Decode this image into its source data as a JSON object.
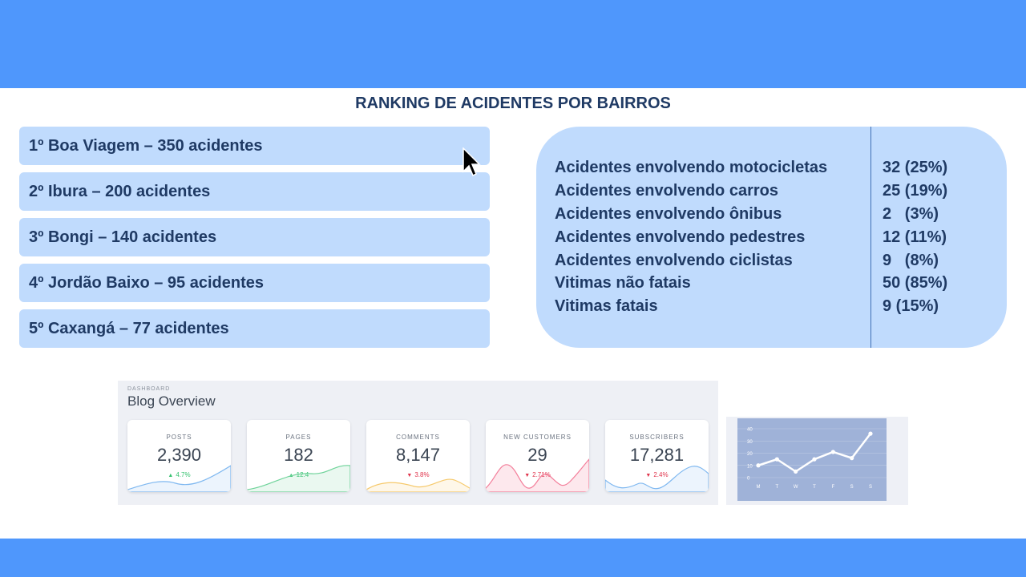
{
  "title": "RANKING DE ACIDENTES POR BAIRROS",
  "ranking": [
    "1º Boa Viagem – 350 acidentes",
    "2º Ibura – 200 acidentes",
    "3º Bongi – 140 acidentes",
    "4º Jordão Baixo – 95 acidentes",
    "5º Caxangá – 77 acidentes"
  ],
  "stats": [
    {
      "label": "Acidentes envolvendo motocicletas",
      "value": "32 (25%)"
    },
    {
      "label": "Acidentes envolvendo carros",
      "value": "25 (19%)"
    },
    {
      "label": "Acidentes envolvendo ônibus",
      "value": "2   (3%)"
    },
    {
      "label": "Acidentes envolvendo pedestres",
      "value": "12 (11%)"
    },
    {
      "label": "Acidentes envolvendo ciclistas",
      "value": "9   (8%)"
    },
    {
      "label": "Vitimas não fatais",
      "value": "50 (85%)"
    },
    {
      "label": "Vitimas fatais",
      "value": "9 (15%)"
    }
  ],
  "dashboard": {
    "kicker": "DASHBOARD",
    "title": "Blog Overview",
    "cards": [
      {
        "label": "POSTS",
        "value": "2,390",
        "change": "4.7%",
        "direction": "up",
        "color": "#7fb8f0"
      },
      {
        "label": "PAGES",
        "value": "182",
        "change": "12.4",
        "direction": "up",
        "color": "#6fd39a"
      },
      {
        "label": "COMMENTS",
        "value": "8,147",
        "change": "3.8%",
        "direction": "down",
        "color": "#f6c96b"
      },
      {
        "label": "NEW CUSTOMERS",
        "value": "29",
        "change": "2.71%",
        "direction": "down",
        "color": "#f37e9a"
      },
      {
        "label": "SUBSCRIBERS",
        "value": "17,281",
        "change": "2.4%",
        "direction": "down",
        "color": "#7fb8f0"
      }
    ],
    "colors": {
      "up": "#35c26f",
      "down": "#e0344c"
    }
  },
  "chart_data": {
    "type": "line",
    "categories": [
      "M",
      "T",
      "W",
      "T",
      "F",
      "S",
      "S"
    ],
    "values": [
      10,
      15,
      5,
      15,
      21,
      16,
      36
    ],
    "ylim": [
      0,
      40
    ],
    "yticks": [
      "0",
      "10",
      "20",
      "30",
      "40"
    ],
    "grid": true,
    "line_color": "#ffffff",
    "background": "#9fb2d8"
  },
  "colors": {
    "band": "#4f97fc",
    "panel": "#c0dbfd",
    "text": "#1f3a64"
  }
}
